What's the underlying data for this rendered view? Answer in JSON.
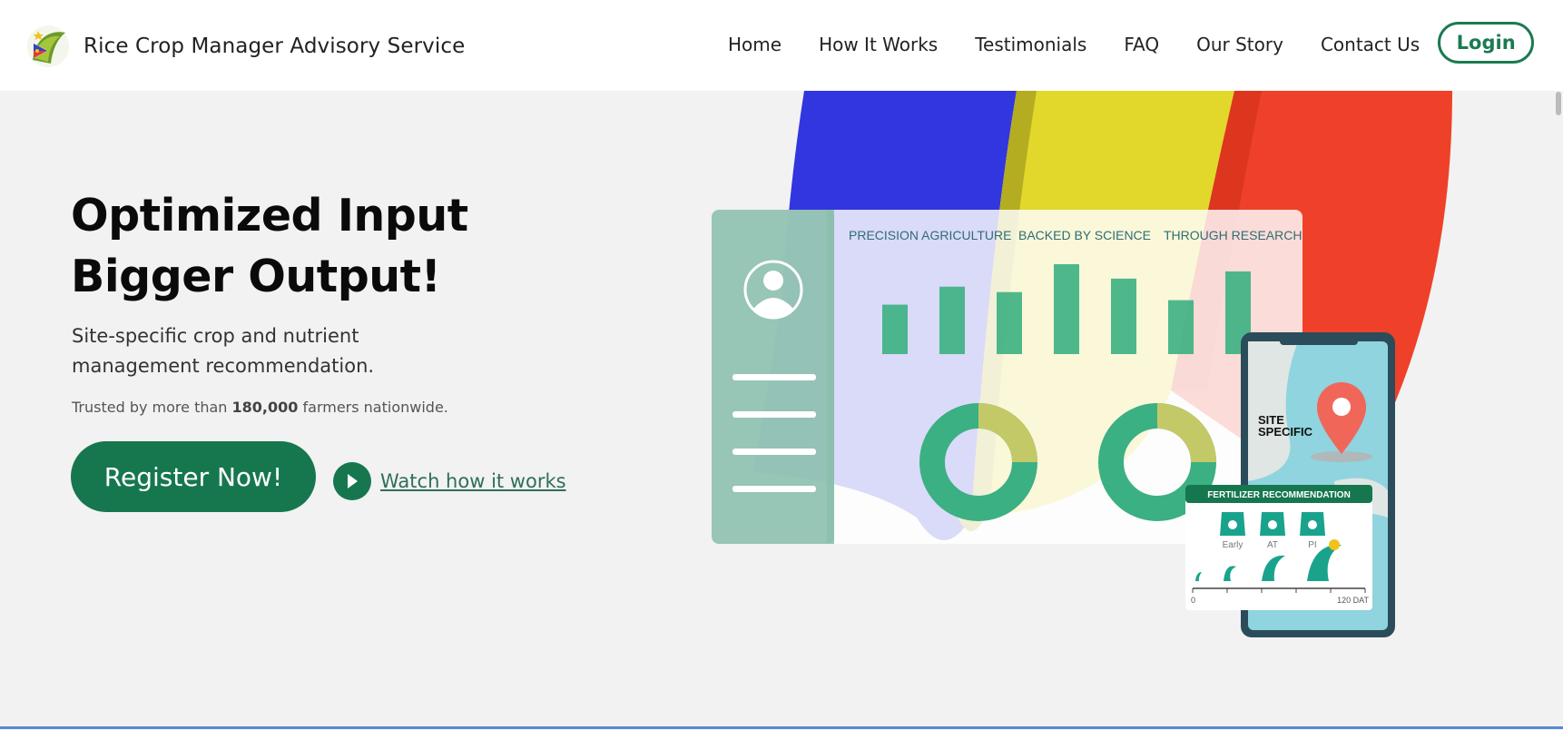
{
  "brand": {
    "name": "Rice Crop Manager Advisory Service",
    "logo_icon": "ph-flag-swirl-logo"
  },
  "nav": {
    "items": [
      {
        "label": "Home"
      },
      {
        "label": "How It Works"
      },
      {
        "label": "Testimonials"
      },
      {
        "label": "FAQ"
      },
      {
        "label": "Our Story"
      },
      {
        "label": "Contact Us"
      }
    ],
    "login_label": "Login"
  },
  "hero": {
    "headline_line1": "Optimized Input",
    "headline_line2": "Bigger Output!",
    "subline": "Site-specific crop and nutrient management recommendation.",
    "trust_prefix": "Trusted by more than",
    "trust_count": "180,000",
    "trust_suffix": "farmers nationwide.",
    "register_label": "Register Now!",
    "watch_label": "Watch how it works"
  },
  "illustration": {
    "tags": [
      "PRECISION AGRICULTURE",
      "BACKED BY SCIENCE",
      "THROUGH RESEARCH"
    ],
    "bar_levels": [
      0.55,
      0.75,
      0.69,
      1.0,
      0.84,
      0.6,
      0.92
    ],
    "site_label_1": "SITE",
    "site_label_2": "SPECIFIC",
    "fert_title": "FERTILIZER RECOMMENDATION",
    "fert_stages": [
      "Early",
      "AT",
      "PI"
    ],
    "timeline_start": "0",
    "timeline_end": "120 DAT"
  },
  "colors": {
    "brand_green": "#16774f",
    "flag_blue": "#3236de",
    "flag_yellow": "#e2d82c",
    "flag_red": "#ef4129",
    "chart_green": "#3bb082"
  }
}
